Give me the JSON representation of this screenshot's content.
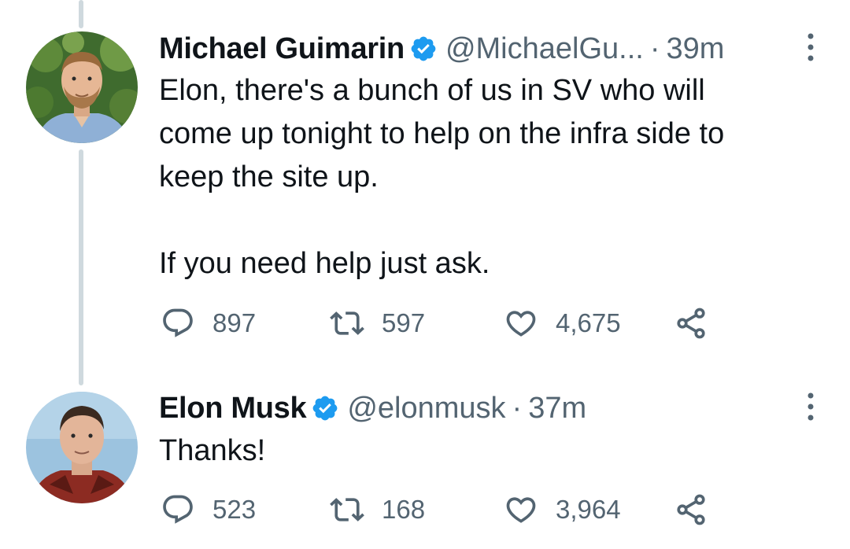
{
  "tweets": [
    {
      "author_name": "Michael Guimarin",
      "handle": "@MichaelGu...",
      "separator": "·",
      "time": "39m",
      "verified": true,
      "text": "Elon, there's a bunch of us in SV who will\ncome up tonight to help on the infra side to\nkeep the site up.\n\nIf you need help just ask.",
      "replies": "897",
      "retweets": "597",
      "likes": "4,675"
    },
    {
      "author_name": "Elon Musk",
      "handle": "@elonmusk",
      "separator": "·",
      "time": "37m",
      "verified": true,
      "text": "Thanks!",
      "replies": "523",
      "retweets": "168",
      "likes": "3,964"
    }
  ],
  "icons": {
    "reply": "reply-icon",
    "retweet": "retweet-icon",
    "like": "heart-icon",
    "share": "share-icon",
    "verified": "verified-badge-icon",
    "more": "more-options-icon"
  },
  "colors": {
    "verified_blue": "#1d9bf0",
    "secondary_text": "#536471",
    "primary_text": "#0f1419",
    "thread_line": "#cfd9de"
  }
}
